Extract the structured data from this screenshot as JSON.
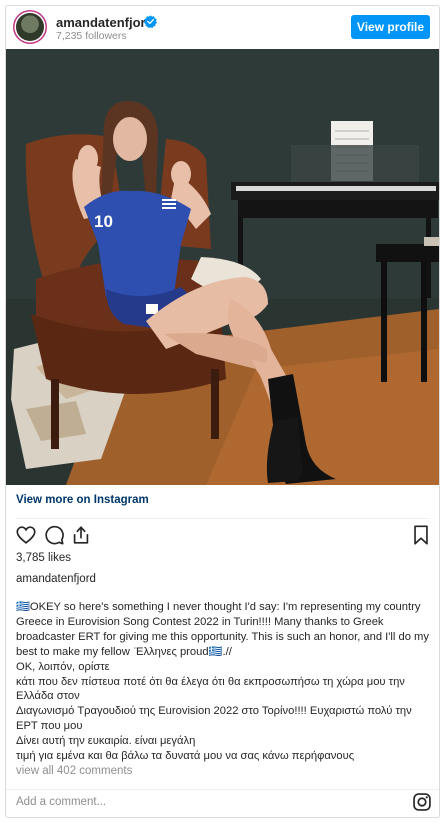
{
  "header": {
    "username": "amandatenfjord",
    "followers": "7,235 followers",
    "view_profile_label": "View profile"
  },
  "photo": {
    "jersey_number": "10"
  },
  "view_more_label": "View more on Instagram",
  "likes": "3,785 likes",
  "caption_owner": "amandatenfjord",
  "caption": "🇬🇷OKEY so here's something I never thought I'd say: I'm representing my country Greece in Eurovision Song Contest 2022 in Turin!!!! Many thanks to Greek broadcaster ERT for giving me this opportunity. This is such an honor, and I'll do my best to make my fellow  ̈Ελληνες proud🇬🇷.//\nΟΚ, λοιπόν, ορίστε\nκάτι που δεν πίστευα ποτέ ότι θα έλεγα ότι θα εκπροσωπήσω τη χώρα μου την Ελλάδα στον\nΔιαγωνισμό Τραγουδιού της Eurovision 2022 στο Τορίνο!!!! Ευχαριστώ πολύ την ΕΡΤ που μου\nΔίνει αυτή την ευκαιρία. είναι μεγάλη\nτιμή για εμένα και θα βάλω τα δυνατά μου να σας κάνω περήφανους",
  "view_all_comments": "view all 402 comments",
  "add_comment_placeholder": "Add a comment...",
  "colors": {
    "accent": "#0095f6",
    "link": "#00376b",
    "muted": "#8e8e8e",
    "jersey": "#2f4fb0"
  },
  "icons": [
    "verified-badge-icon",
    "heart-icon",
    "comment-icon",
    "share-icon",
    "bookmark-icon",
    "instagram-icon"
  ]
}
